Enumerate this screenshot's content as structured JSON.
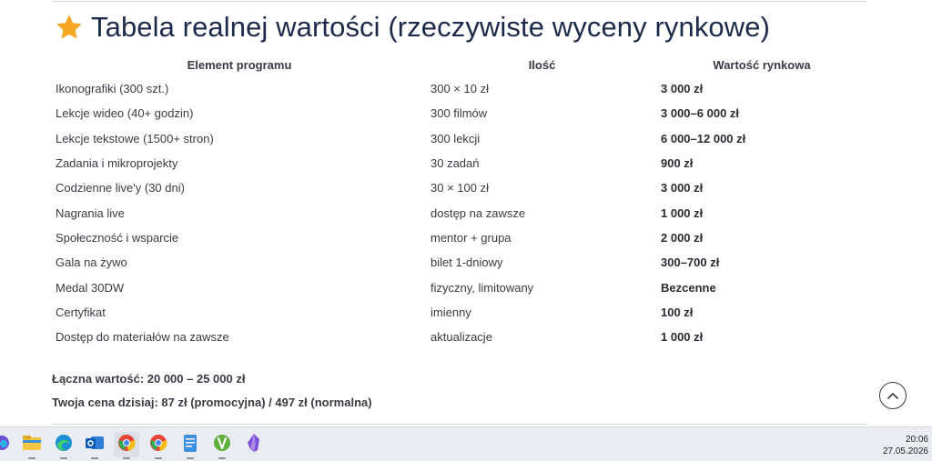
{
  "page": {
    "title": "Tabela realnej wartości (rzeczywiste wyceny rynkowe)",
    "title_icon": "star-icon"
  },
  "table": {
    "headers": [
      "Element programu",
      "Ilość",
      "Wartość rynkowa"
    ],
    "rows": [
      {
        "element": "Ikonografiki (300 szt.)",
        "qty": "300 × 10 zł",
        "value": "3 000 zł"
      },
      {
        "element": "Lekcje wideo (40+ godzin)",
        "qty": "300 filmów",
        "value": "3 000–6 000 zł"
      },
      {
        "element": "Lekcje tekstowe (1500+ stron)",
        "qty": "300 lekcji",
        "value": "6 000–12 000 zł"
      },
      {
        "element": "Zadania i mikroprojekty",
        "qty": "30 zadań",
        "value": "900 zł"
      },
      {
        "element": "Codzienne live'y (30 dni)",
        "qty": "30 × 100 zł",
        "value": "3 000 zł"
      },
      {
        "element": "Nagrania live",
        "qty": "dostęp na zawsze",
        "value": "1 000 zł"
      },
      {
        "element": "Społeczność i wsparcie",
        "qty": "mentor + grupa",
        "value": "2 000 zł"
      },
      {
        "element": "Gala na żywo",
        "qty": "bilet 1-dniowy",
        "value": "300–700 zł"
      },
      {
        "element": "Medal 30DW",
        "qty": "fizyczny, limitowany",
        "value": "Bezcenne"
      },
      {
        "element": "Certyfikat",
        "qty": "imienny",
        "value": "100 zł"
      },
      {
        "element": "Dostęp do materiałów na zawsze",
        "qty": "aktualizacje",
        "value": "1 000 zł"
      }
    ]
  },
  "summary": {
    "total": "Łączna wartość: 20 000 – 25 000 zł",
    "price": "Twoja cena dzisiaj: 87 zł (promocyjna) / 497 zł (normalna)"
  },
  "scroll_top": {
    "icon": "chevron-up-icon"
  },
  "taskbar": {
    "apps": [
      "edge-icon",
      "file-explorer-icon",
      "edge-icon",
      "outlook-icon",
      "chrome-icon",
      "chrome-icon",
      "notepad-icon",
      "app-icon",
      "obsidian-icon"
    ],
    "time": "20:06",
    "date": "27.05.2026"
  },
  "colors": {
    "accent_star": "#f5a623",
    "title": "#1e2a4a",
    "text": "#3a3a46"
  }
}
